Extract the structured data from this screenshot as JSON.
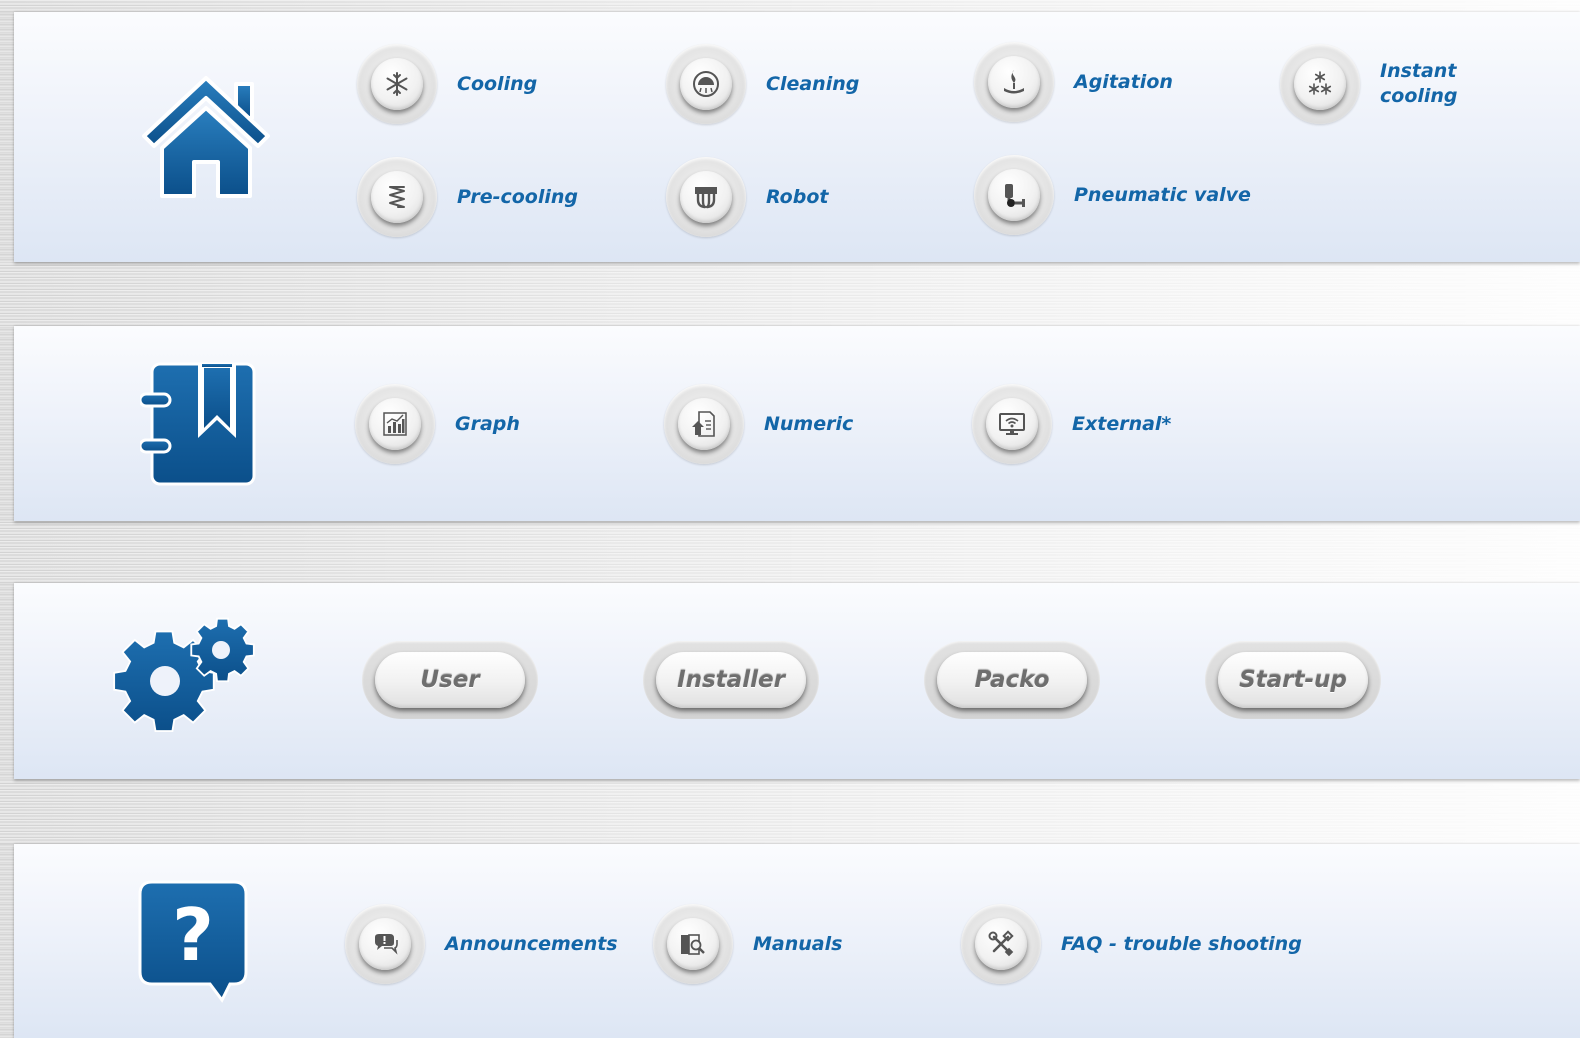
{
  "colors": {
    "accent_blue": "#1366a8",
    "icon_blue": "#0b5b9a",
    "icon_gray": "#555555",
    "pill_text": "#6e6e6e"
  },
  "sections": [
    {
      "icon": "house-icon",
      "items": [
        {
          "label": "Cooling",
          "icon": "snowflake-icon"
        },
        {
          "label": "Cleaning",
          "icon": "shower-head-icon"
        },
        {
          "label": "Agitation",
          "icon": "agitator-icon"
        },
        {
          "label": "Instant\ncooling",
          "icon": "multi-snowflake-icon"
        },
        {
          "label": "Pre-cooling",
          "icon": "coil-icon"
        },
        {
          "label": "Robot",
          "icon": "robot-icon"
        },
        {
          "label": "Pneumatic valve",
          "icon": "valve-icon"
        }
      ]
    },
    {
      "icon": "bookmark-book-icon",
      "items": [
        {
          "label": "Graph",
          "icon": "bar-chart-icon"
        },
        {
          "label": "Numeric",
          "icon": "numeric-document-icon"
        },
        {
          "label": "External*",
          "icon": "wifi-monitor-icon"
        }
      ]
    },
    {
      "icon": "gears-icon",
      "buttons": [
        {
          "label": "User"
        },
        {
          "label": "Installer"
        },
        {
          "label": "Packo"
        },
        {
          "label": "Start-up"
        }
      ]
    },
    {
      "icon": "question-bubble-icon",
      "items": [
        {
          "label": "Announcements",
          "icon": "chat-alert-icon"
        },
        {
          "label": "Manuals",
          "icon": "manual-search-icon"
        },
        {
          "label": "FAQ - trouble shooting",
          "icon": "tools-icon"
        }
      ]
    }
  ]
}
